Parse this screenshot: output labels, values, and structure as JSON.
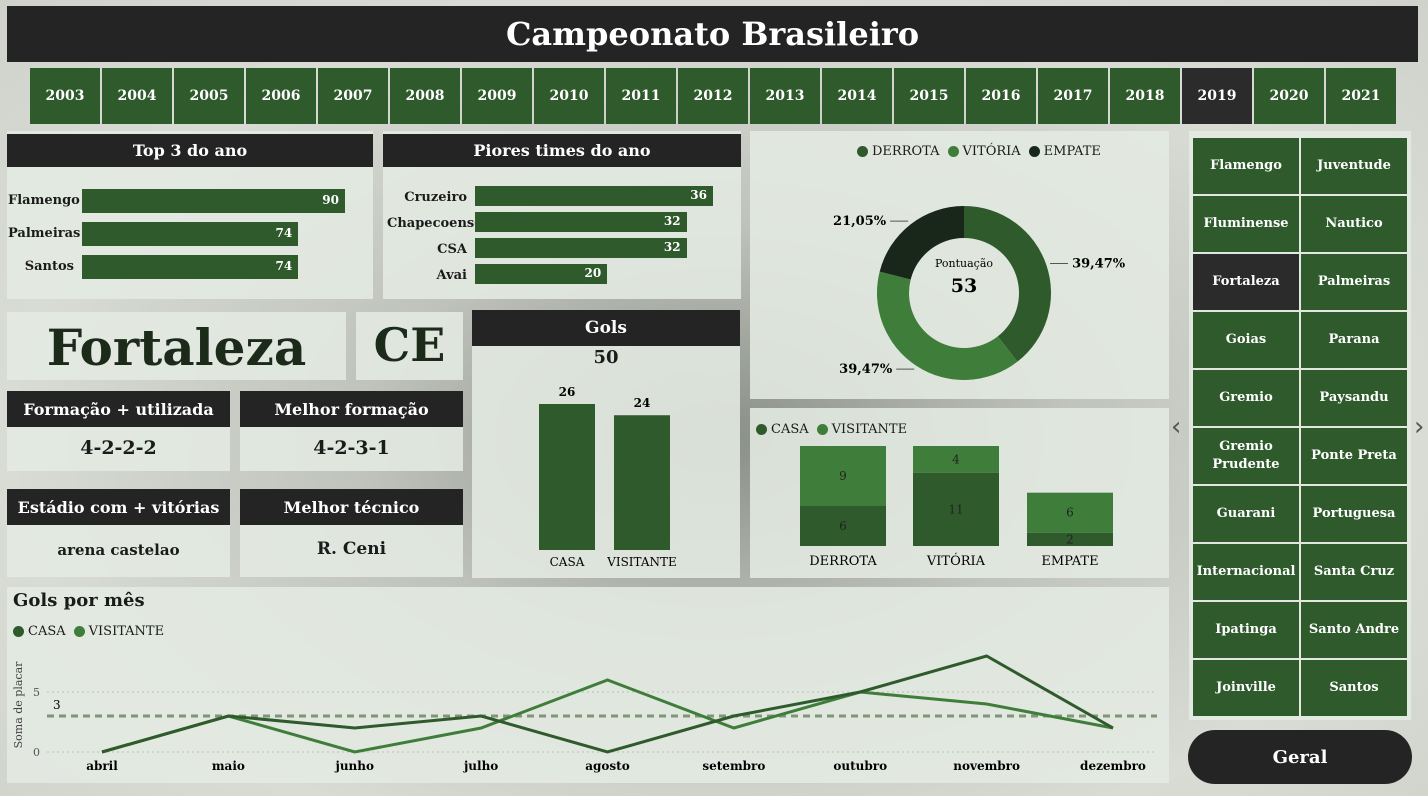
{
  "title": "Campeonato Brasileiro",
  "years": [
    "2003",
    "2004",
    "2005",
    "2006",
    "2007",
    "2008",
    "2009",
    "2010",
    "2011",
    "2012",
    "2013",
    "2014",
    "2015",
    "2016",
    "2017",
    "2018",
    "2019",
    "2020",
    "2021"
  ],
  "selected_year": "2019",
  "top3": {
    "title": "Top 3 do ano",
    "teams": [
      "Flamengo",
      "Palmeiras",
      "Santos"
    ],
    "values": [
      "90",
      "74",
      "74"
    ],
    "max": 90
  },
  "worst": {
    "title": "Piores times do ano",
    "teams": [
      "Cruzeiro",
      "Chapecoense",
      "CSA",
      "Avai"
    ],
    "values": [
      "36",
      "32",
      "32",
      "20"
    ],
    "max": 36
  },
  "team_card": {
    "name": "Fortaleza",
    "state": "CE"
  },
  "info": {
    "formacao_title": "Formação + utilizada",
    "formacao_value": "4-2-2-2",
    "melhor_formacao_title": "Melhor formação",
    "melhor_formacao_value": "4-2-3-1",
    "estadio_title": "Estádio com + vitórias",
    "estadio_value": "arena castelao",
    "tecnico_title": "Melhor técnico",
    "tecnico_value": "R. Ceni"
  },
  "gols": {
    "title": "Gols",
    "total": "50",
    "categories": [
      "CASA",
      "VISITANTE"
    ],
    "values": [
      "26",
      "24"
    ],
    "max": 26
  },
  "donut": {
    "center_label": "Pontuação",
    "center_value": "53",
    "legend": [
      "DERROTA",
      "VITÓRIA",
      "EMPATE"
    ],
    "pct_derrota": "39,47%",
    "pct_vitoria": "39,47%",
    "pct_empate": "21,05%",
    "values": [
      39.47,
      39.47,
      21.05
    ],
    "colors": [
      "#2f5a2c",
      "#3f7d3a",
      "#18271a"
    ]
  },
  "results": {
    "legend": [
      "CASA",
      "VISITANTE"
    ],
    "categories": [
      "DERROTA",
      "VITÓRIA",
      "EMPATE"
    ],
    "casa": [
      "6",
      "11",
      "2"
    ],
    "visitante": [
      "9",
      "4",
      "6"
    ],
    "max": 15
  },
  "monthly": {
    "title": "Gols por mês",
    "legend": [
      "CASA",
      "VISITANTE"
    ],
    "ylabel": "Soma de placar",
    "months": [
      "abril",
      "maio",
      "junho",
      "julho",
      "agosto",
      "setembro",
      "outubro",
      "novembro",
      "dezembro"
    ],
    "casa": [
      0,
      3,
      2,
      3,
      0,
      3,
      5,
      8,
      2
    ],
    "visitante": [
      0,
      3,
      0,
      2,
      6,
      2,
      5,
      4,
      2
    ],
    "avg_label": "3",
    "avg": 3,
    "y_ticks": [
      "0",
      "5"
    ],
    "ylim": [
      0,
      8.5
    ]
  },
  "teams": [
    "Flamengo",
    "Juventude",
    "Fluminense",
    "Nautico",
    "Fortaleza",
    "Palmeiras",
    "Goias",
    "Parana",
    "Gremio",
    "Paysandu",
    "Gremio Prudente",
    "Ponte Preta",
    "Guarani",
    "Portuguesa",
    "Internacional",
    "Santa Cruz",
    "Ipatinga",
    "Santo Andre",
    "Joinville",
    "Santos"
  ],
  "selected_team": "Fortaleza",
  "geral_label": "Geral",
  "colors": {
    "casa": "#2f5a2c",
    "visitante": "#3f7d3a",
    "dark": "#242424"
  }
}
